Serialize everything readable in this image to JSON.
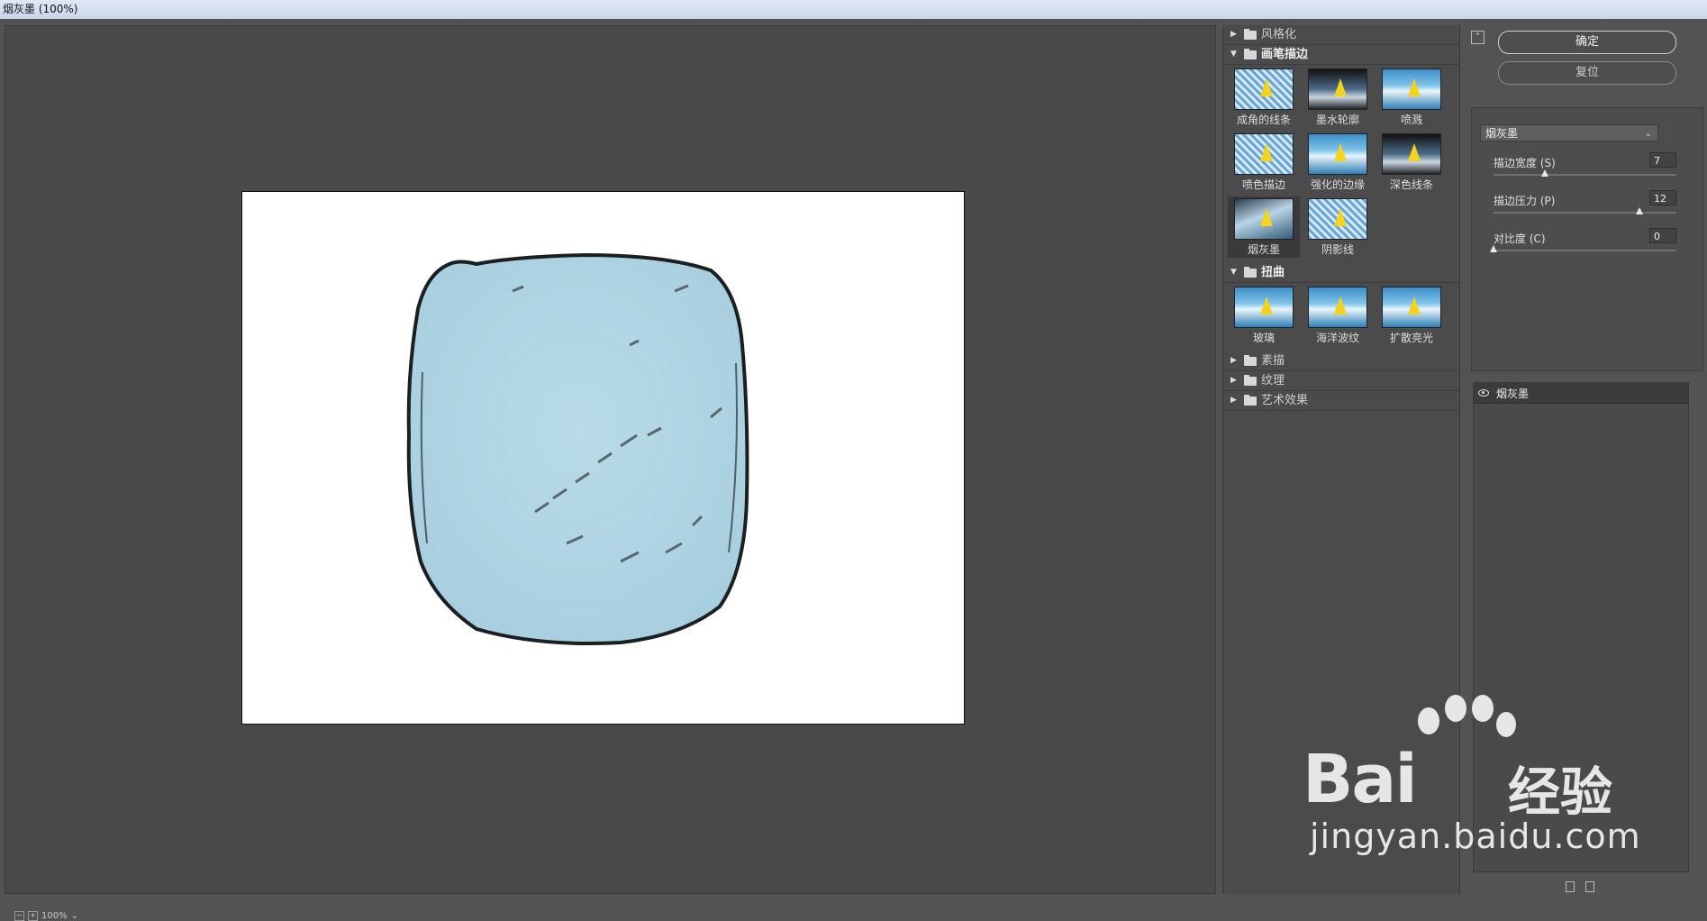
{
  "window": {
    "title": "烟灰墨 (100%)"
  },
  "preview": {
    "zoom": "100%",
    "zoom_out": "−",
    "zoom_in": "+",
    "zoom_chevron": "⌄"
  },
  "gallery": {
    "categories": [
      {
        "label": "风格化",
        "expanded": false
      },
      {
        "label": "画笔描边",
        "expanded": true,
        "filters": [
          "成角的线条",
          "墨水轮廓",
          "喷溅",
          "喷色描边",
          "强化的边缘",
          "深色线条",
          "烟灰墨",
          "阴影线"
        ],
        "selected": "烟灰墨"
      },
      {
        "label": "扭曲",
        "expanded": true,
        "filters": [
          "玻璃",
          "海洋波纹",
          "扩散亮光"
        ]
      },
      {
        "label": "素描",
        "expanded": false
      },
      {
        "label": "纹理",
        "expanded": false
      },
      {
        "label": "艺术效果",
        "expanded": false
      }
    ]
  },
  "settings": {
    "ok_label": "确定",
    "reset_label": "复位",
    "filter_select": "烟灰墨",
    "params": [
      {
        "label": "描边宽度 (S)",
        "value": "7",
        "level": 0.28
      },
      {
        "label": "描边压力 (P)",
        "value": "12",
        "level": 0.8
      },
      {
        "label": "对比度 (C)",
        "value": "0",
        "level": 0.0
      }
    ]
  },
  "layers": {
    "items": [
      {
        "name": "烟灰墨",
        "visible": true
      }
    ]
  },
  "watermark": {
    "brand": "Bai",
    "brand_cn": "经验",
    "url": "jingyan.baidu.com"
  },
  "colors": {
    "canvas_bg": "#ffffff",
    "shape_fill": "#afd3e1",
    "panel_bg": "#4a4a4a"
  }
}
